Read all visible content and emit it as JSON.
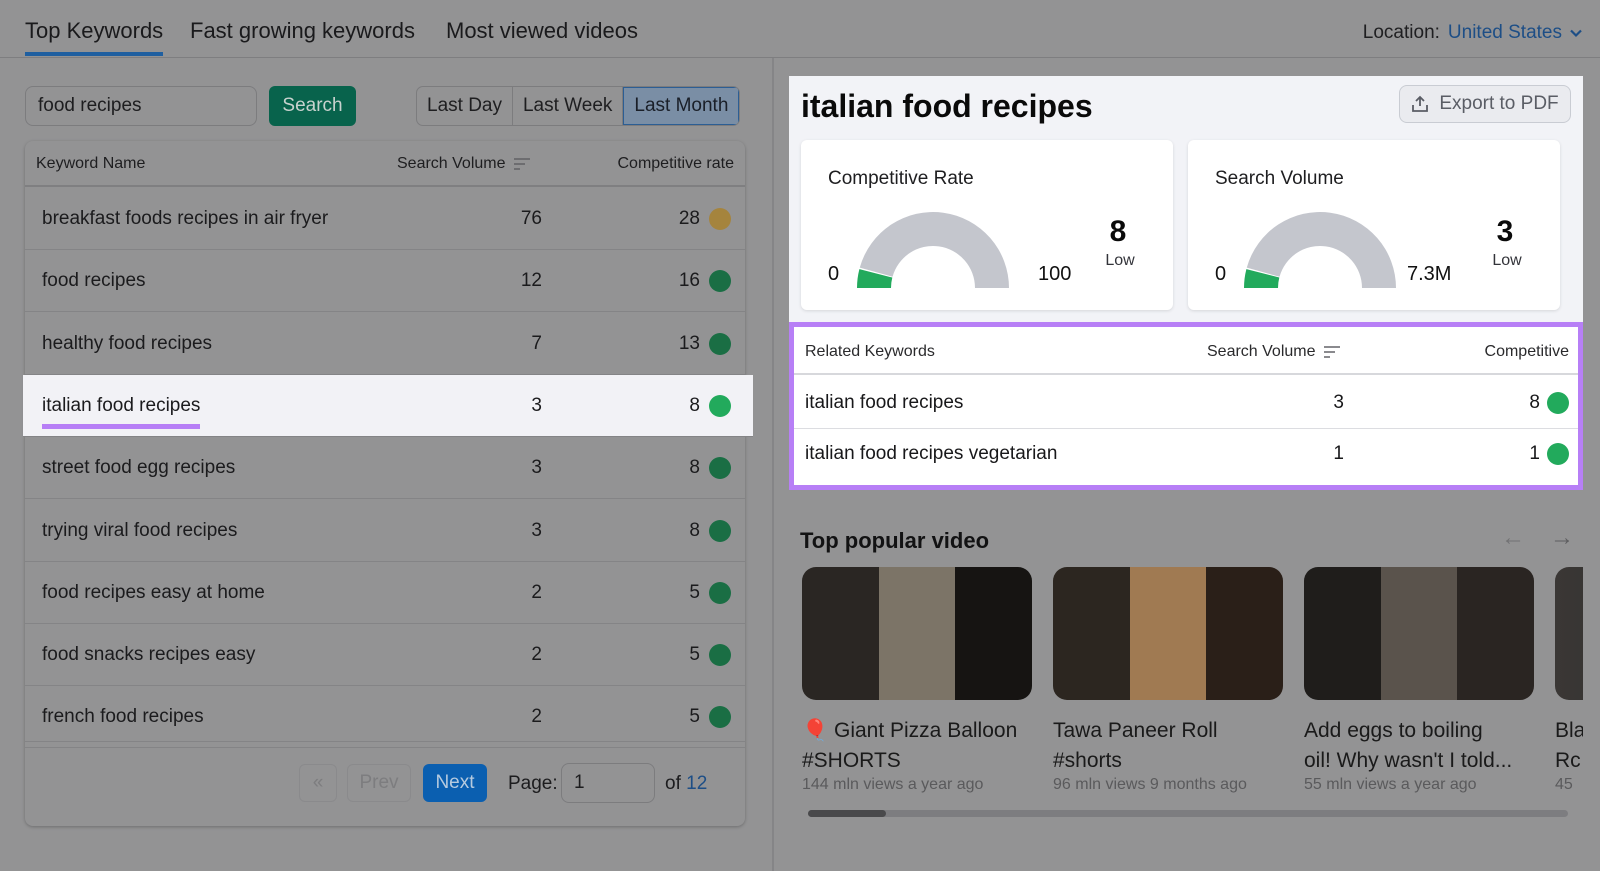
{
  "tabs": [
    {
      "label": "Top Keywords",
      "active": true
    },
    {
      "label": "Fast growing keywords",
      "active": false
    },
    {
      "label": "Most viewed videos",
      "active": false
    }
  ],
  "location": {
    "label": "Location:",
    "value": "United States"
  },
  "search": {
    "value": "food recipes",
    "button": "Search"
  },
  "time_range": {
    "options": [
      "Last Day",
      "Last Week",
      "Last Month"
    ],
    "selected": "Last Month"
  },
  "keyword_table": {
    "headers": {
      "name": "Keyword Name",
      "volume": "Search Volume",
      "competitive": "Competitive rate"
    },
    "rows": [
      {
        "name": "breakfast foods recipes in air fryer",
        "volume": "76",
        "competitive": "28",
        "color": "#a5843d"
      },
      {
        "name": "food recipes",
        "volume": "12",
        "competitive": "16",
        "color": "#1a6e44"
      },
      {
        "name": "healthy food recipes",
        "volume": "7",
        "competitive": "13",
        "color": "#1a6e44"
      },
      {
        "name": "italian food recipes",
        "volume": "3",
        "competitive": "8",
        "color": "#22aa5c",
        "selected": true
      },
      {
        "name": "street food egg recipes",
        "volume": "3",
        "competitive": "8",
        "color": "#1a6e44"
      },
      {
        "name": "trying viral food recipes",
        "volume": "3",
        "competitive": "8",
        "color": "#1a6e44"
      },
      {
        "name": "food recipes easy at home",
        "volume": "2",
        "competitive": "5",
        "color": "#1a6e44"
      },
      {
        "name": "food snacks recipes easy",
        "volume": "2",
        "competitive": "5",
        "color": "#1a6e44"
      },
      {
        "name": "french food recipes",
        "volume": "2",
        "competitive": "5",
        "color": "#1a6e44"
      }
    ]
  },
  "pagination": {
    "first": "«",
    "prev": "Prev",
    "next": "Next",
    "page_label": "Page:",
    "page": "1",
    "of_label": "of",
    "total": "12"
  },
  "detail": {
    "title": "italian food recipes",
    "export_label": "Export to PDF",
    "competitive_card": {
      "title": "Competitive Rate",
      "min": "0",
      "max": "100",
      "value": "8",
      "level": "Low",
      "fraction": 0.08
    },
    "volume_card": {
      "title": "Search Volume",
      "min": "0",
      "max": "7.3M",
      "value": "3",
      "level": "Low",
      "fraction": 0.08
    },
    "related": {
      "headers": {
        "name": "Related Keywords",
        "volume": "Search Volume",
        "competitive": "Competitive"
      },
      "rows": [
        {
          "name": "italian food recipes",
          "volume": "3",
          "competitive": "8"
        },
        {
          "name": "italian food recipes vegetarian",
          "volume": "1",
          "competitive": "1"
        }
      ]
    }
  },
  "popular_videos": {
    "title": "Top popular video",
    "videos": [
      {
        "title": "🎈 Giant Pizza Balloon\n#SHORTS",
        "meta": "144 mln views a year ago"
      },
      {
        "title": "Tawa Paneer Roll\n#shorts",
        "meta": "96 mln views 9 months ago"
      },
      {
        "title": "Add eggs to boiling\noil! Why wasn't I told...",
        "meta": "55 mln views a year ago"
      },
      {
        "title": "Bla\nRc",
        "meta": "45"
      }
    ],
    "scroll_fraction": 0.1
  },
  "colors": {
    "accent": "#1f5fa0",
    "search_button": "#08634c",
    "highlight": "#b77ff6",
    "low_green": "#22aa5c",
    "gauge_track": "#c4c6cd"
  }
}
